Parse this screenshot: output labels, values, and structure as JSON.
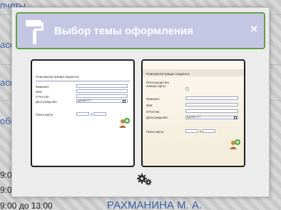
{
  "background": {
    "fragments": [
      "пчеты",
      "ассч",
      "ассо",
      "обно"
    ],
    "times": [
      "9:00",
      "9:00",
      "9:00 до 13:00"
    ],
    "doctor_name": "РАХМАНИНА М. А."
  },
  "modal": {
    "title": "Выбор темы оформления",
    "close_label": "×",
    "header_color": "#c5c6e4",
    "header_border": "#62a246"
  },
  "themes": [
    {
      "title": "Поиск/регистрация пациента",
      "fields": [
        "Фамилия:",
        "Имя:",
        "Отчество:",
        "Дата рождения:"
      ],
      "date_placeholder": "ДД.ММ.ГГГГ",
      "card_search_label": "Поиск карты:",
      "range_sep": "д"
    },
    {
      "title": "Поиск/регистрация пациента",
      "no_card_line1": "Регистрация без",
      "no_card_line2": "номера карты:",
      "fields": [
        "Фамилия:",
        "Имя:",
        "Отчество:",
        "Дата рождения:"
      ],
      "date_placeholder": "ДД.ММ.ГГГГ",
      "card_search_label": "Поиск карты:",
      "range_sep": "д"
    }
  ],
  "icons": {
    "header": "paint-roller-icon",
    "settings": "gears-icon"
  }
}
